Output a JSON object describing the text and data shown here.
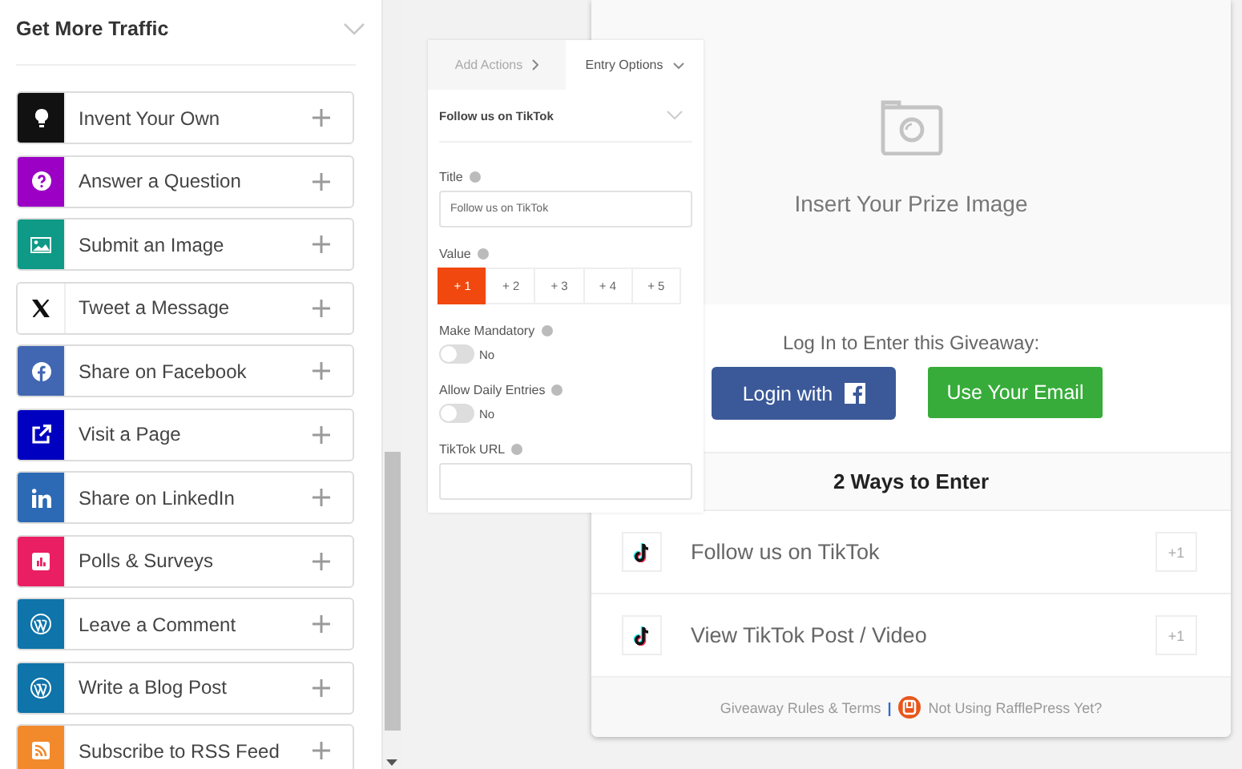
{
  "sidebar": {
    "title": "Get More Traffic",
    "items": [
      {
        "label": "Invent Your Own",
        "kind": "bulb",
        "color": "#111111"
      },
      {
        "label": "Answer a Question",
        "kind": "question",
        "color": "#9b00c4"
      },
      {
        "label": "Submit an Image",
        "kind": "image",
        "color": "#0e9a86"
      },
      {
        "label": "Tweet a Message",
        "kind": "x",
        "color": "#ffffff"
      },
      {
        "label": "Share on Facebook",
        "kind": "facebook",
        "color": "#4267b2"
      },
      {
        "label": "Visit a Page",
        "kind": "external",
        "color": "#0000c0"
      },
      {
        "label": "Share on LinkedIn",
        "kind": "linkedin",
        "color": "#2c6ab5"
      },
      {
        "label": "Polls & Surveys",
        "kind": "chart",
        "color": "#ea1e63"
      },
      {
        "label": "Leave a Comment",
        "kind": "wordpress",
        "color": "#0e74aa"
      },
      {
        "label": "Write a Blog Post",
        "kind": "wordpress",
        "color": "#0e74aa"
      },
      {
        "label": "Subscribe to RSS Feed",
        "kind": "rss",
        "color": "#f28a2c"
      }
    ]
  },
  "options_panel": {
    "tabs": [
      {
        "label": "Add Actions",
        "selected": false
      },
      {
        "label": "Entry Options",
        "selected": true
      }
    ],
    "heading": "Follow us on TikTok",
    "title_field": {
      "label": "Title",
      "value": "Follow us on TikTok"
    },
    "value_field": {
      "label": "Value",
      "options": [
        {
          "label": "+ 1",
          "selected": true
        },
        {
          "label": "+ 2",
          "selected": false
        },
        {
          "label": "+ 3",
          "selected": false
        },
        {
          "label": "+ 4",
          "selected": false
        },
        {
          "label": "+ 5",
          "selected": false
        }
      ]
    },
    "toggles": [
      {
        "label": "Make Mandatory",
        "on": false,
        "state_text": "No"
      },
      {
        "label": "Allow Daily Entries",
        "on": false,
        "state_text": "No"
      }
    ],
    "url_field": {
      "label": "TikTok URL"
    }
  },
  "preview": {
    "prize_image_text": "Insert Your Prize Image",
    "login_prompt": "Log In to Enter this Giveaway:",
    "login_button": "Login with",
    "email_button": "Use Your Email",
    "ways_heading": "2 Ways to Enter",
    "entries": [
      {
        "label": "Follow us on TikTok",
        "points": "+1"
      },
      {
        "label": "View TikTok Post / Video",
        "points": "+1"
      }
    ],
    "footer": {
      "rules_link": "Giveaway Rules & Terms",
      "separator": "|",
      "promo_link": "Not Using RafflePress Yet?"
    }
  }
}
